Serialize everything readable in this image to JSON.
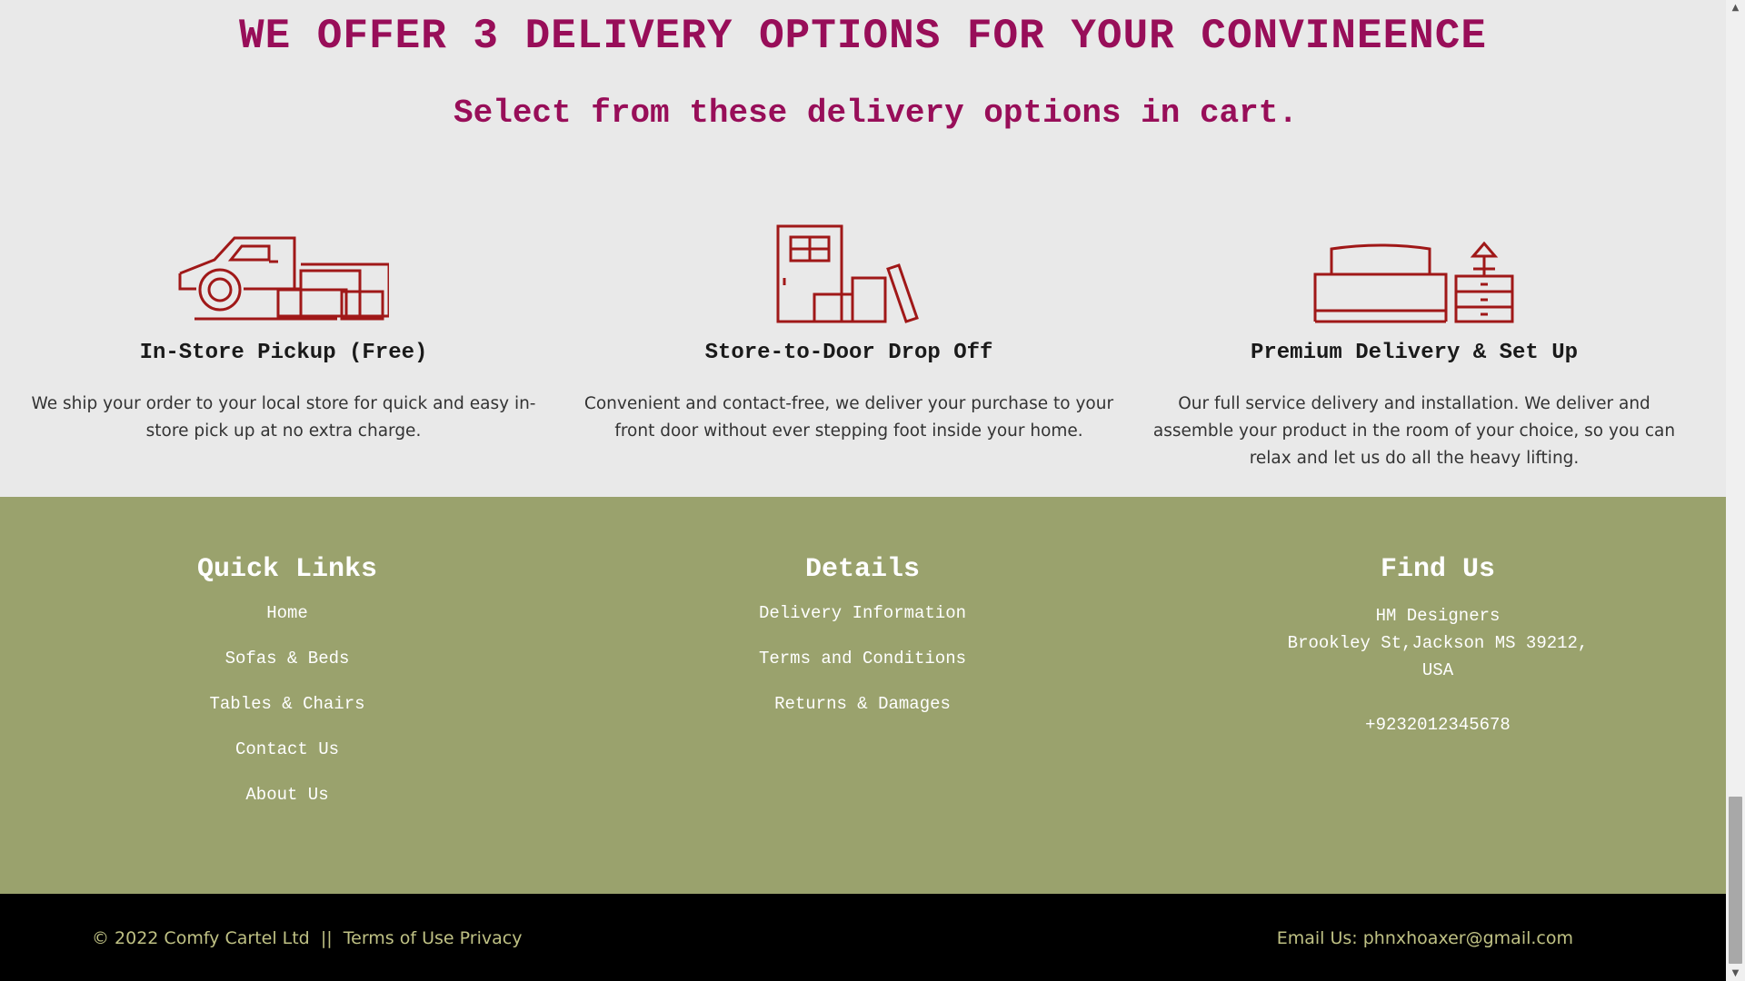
{
  "delivery": {
    "headline": "WE OFFER 3 DELIVERY OPTIONS FOR YOUR CONVINEENCE",
    "subhead": "Select from these delivery options in cart.",
    "accent_color": "#980e59",
    "icon_color": "#a01818",
    "options": [
      {
        "icon": "pickup-truck-icon",
        "title": "In-Store Pickup (Free)",
        "description": "We ship your order to your local store for quick and easy in-store pick up at no extra charge."
      },
      {
        "icon": "door-boxes-icon",
        "title": "Store-to-Door Drop Off",
        "description": "Convenient and contact-free, we deliver your purchase to your front door without ever stepping foot inside your home."
      },
      {
        "icon": "bed-nightstand-icon",
        "title": "Premium Delivery & Set Up",
        "description": "Our full service delivery and installation. We deliver and assemble your product in the room of your choice, so you can relax and let us do all the heavy lifting."
      }
    ]
  },
  "footer": {
    "background": "#9aa26d",
    "quick_links": {
      "heading": "Quick Links",
      "items": [
        "Home",
        "Sofas & Beds",
        "Tables & Chairs",
        "Contact Us",
        "About Us"
      ]
    },
    "details": {
      "heading": "Details",
      "items": [
        "Delivery Information",
        "Terms and Conditions",
        "Returns & Damages"
      ]
    },
    "find_us": {
      "heading": "Find Us",
      "company": "HM Designers",
      "address_line": "Brookley St,Jackson MS 39212,",
      "country": "USA",
      "phone": "+9232012345678"
    }
  },
  "bottom_bar": {
    "copyright": "© 2022 Comfy Cartel Ltd",
    "separator": "||",
    "terms_link": "Terms of Use",
    "privacy_link": "Privacy",
    "email": "Email Us: phnxhoaxer@gmail.com",
    "text_color": "#bfc184"
  }
}
